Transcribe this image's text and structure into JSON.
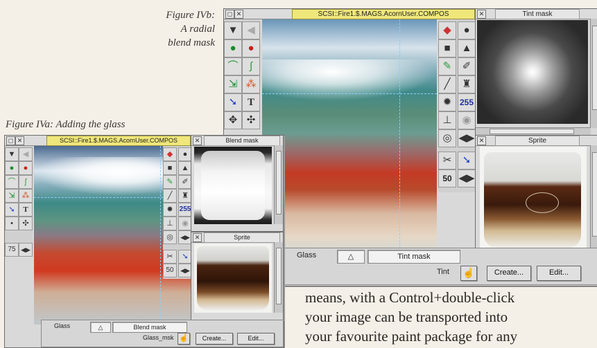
{
  "captions": {
    "fig_b": [
      "Figure IVb:",
      "A radial",
      "blend mask"
    ],
    "fig_a": "Figure IVa: Adding the glass"
  },
  "body_text": [
    "means, with a Control+double-click",
    "your image can be transported into",
    "your favourite paint package for any"
  ],
  "large_window": {
    "main_title": "SCSI::Fire1.$.MAGS.AcornUser.COMPOS",
    "tint_title": "Tint mask",
    "sprite_title": "Sprite",
    "tool_number": "255",
    "zoom": "50",
    "glass_label": "Glass",
    "mask_field": "Tint mask",
    "mask_name": "Tint",
    "create_button": "Create...",
    "edit_button": "Edit..."
  },
  "small_window": {
    "main_title": "SCSI::Fire1.$.MAGS.AcornUser.COMPOS",
    "blend_title": "Blend mask",
    "sprite_title": "Sprite",
    "tool_number": "255",
    "zoom": "75",
    "zoom2": "50",
    "glass_label": "Glass",
    "mask_field": "Blend mask",
    "mask_name": "Glass_msk",
    "create_button": "Create...",
    "edit_button": "Edit..."
  },
  "icons": [
    "mask-icon",
    "blob-icon",
    "apple-icon",
    "curve-icon",
    "move-icon",
    "pointer-icon",
    "text-tool-icon",
    "scissors-icon",
    "circle-icon",
    "triangle-icon",
    "pencil-icon",
    "airbrush-icon",
    "paint-can-icon",
    "arrows-icon",
    "pointer-hand-icon"
  ]
}
